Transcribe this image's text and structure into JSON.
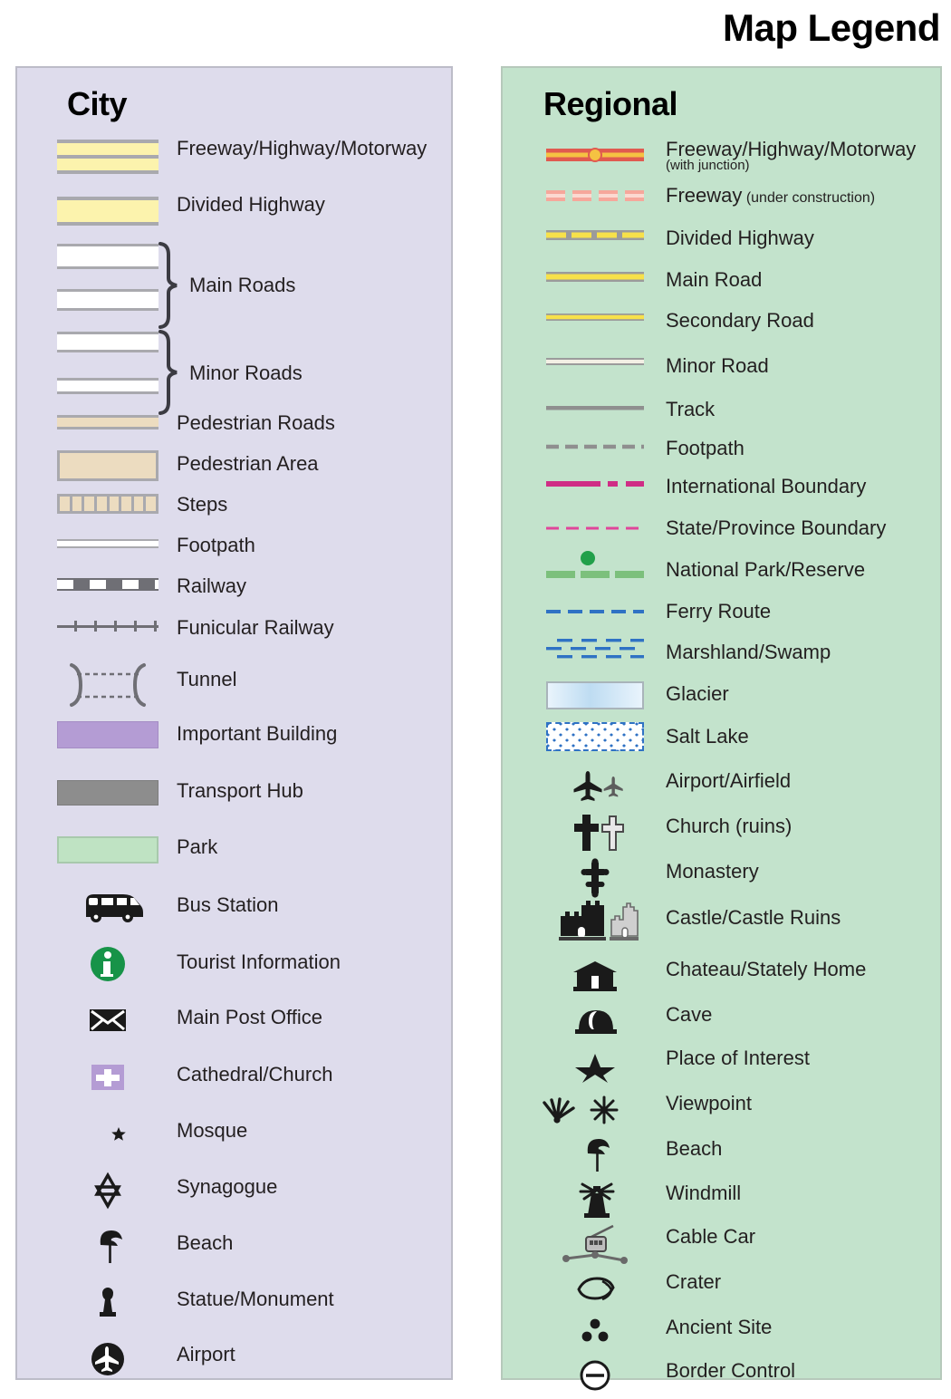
{
  "title": "Map Legend",
  "panels": {
    "city": {
      "heading": "City",
      "bg": "#dedcec",
      "items": [
        {
          "label": "Freeway/Highway/Motorway",
          "symbol": "freeway-double-yellow"
        },
        {
          "label": "Divided Highway",
          "symbol": "divided-highway-yellow"
        },
        {
          "label": "Main Roads",
          "symbol": "main-roads-white-pair-brace"
        },
        {
          "label": "Minor Roads",
          "symbol": "minor-roads-white-pair-brace"
        },
        {
          "label": "Pedestrian Roads",
          "symbol": "pedestrian-road-beige-line"
        },
        {
          "label": "Pedestrian Area",
          "symbol": "pedestrian-area-beige-box"
        },
        {
          "label": "Steps",
          "symbol": "steps-blocks"
        },
        {
          "label": "Footpath",
          "symbol": "footpath-thin-white-line"
        },
        {
          "label": "Railway",
          "symbol": "railway-dashed-gray"
        },
        {
          "label": "Funicular Railway",
          "symbol": "funicular-ticked-line"
        },
        {
          "label": "Tunnel",
          "symbol": "tunnel-dashed-brackets"
        },
        {
          "label": "Important Building",
          "symbol": "important-building-purple-box"
        },
        {
          "label": "Transport Hub",
          "symbol": "transport-hub-gray-box"
        },
        {
          "label": "Park",
          "symbol": "park-green-box"
        },
        {
          "label": "Bus Station",
          "symbol": "bus-icon"
        },
        {
          "label": "Tourist Information",
          "symbol": "tourist-information-icon"
        },
        {
          "label": "Main Post Office",
          "symbol": "envelope-icon"
        },
        {
          "label": "Cathedral/Church",
          "symbol": "cathedral-cross-icon"
        },
        {
          "label": "Mosque",
          "symbol": "mosque-crescent-icon"
        },
        {
          "label": "Synagogue",
          "symbol": "synagogue-star-icon"
        },
        {
          "label": "Beach",
          "symbol": "beach-parasol-icon"
        },
        {
          "label": "Statue/Monument",
          "symbol": "statue-monument-icon"
        },
        {
          "label": "Airport",
          "symbol": "airport-circle-plane-icon"
        }
      ]
    },
    "regional": {
      "heading": "Regional",
      "bg": "#c3e3cc",
      "items": [
        {
          "label": "Freeway/Highway/Motorway",
          "sublabel": "(with junction)",
          "symbol": "freeway-junction-red"
        },
        {
          "label": "Freeway",
          "inline_note": "(under construction)",
          "symbol": "freeway-under-construction-dashes"
        },
        {
          "label": "Divided Highway",
          "symbol": "divided-highway-dashed-yellow"
        },
        {
          "label": "Main Road",
          "symbol": "main-road-yellow"
        },
        {
          "label": "Secondary Road",
          "symbol": "secondary-road-yellow-thin"
        },
        {
          "label": "Minor Road",
          "symbol": "minor-road-white"
        },
        {
          "label": "Track",
          "symbol": "track-gray-solid"
        },
        {
          "label": "Footpath",
          "symbol": "footpath-gray-dashed"
        },
        {
          "label": "International Boundary",
          "symbol": "international-boundary-magenta"
        },
        {
          "label": "State/Province Boundary",
          "symbol": "state-boundary-pink-dashed"
        },
        {
          "label": "National Park/Reserve",
          "symbol": "national-park-green-dash-dot"
        },
        {
          "label": "Ferry Route",
          "symbol": "ferry-route-blue-dashed"
        },
        {
          "label": "Marshland/Swamp",
          "symbol": "marshland-blue-dashes"
        },
        {
          "label": "Glacier",
          "symbol": "glacier-gradient-box"
        },
        {
          "label": "Salt Lake",
          "symbol": "salt-lake-dotted-box"
        },
        {
          "label": "Airport/Airfield",
          "symbol": "airport-airfield-planes-icon"
        },
        {
          "label": "Church (ruins)",
          "symbol": "church-ruins-crosses-icon"
        },
        {
          "label": "Monastery",
          "symbol": "monastery-cross-icon"
        },
        {
          "label": "Castle/Castle Ruins",
          "symbol": "castle-ruins-icon"
        },
        {
          "label": "Chateau/Stately Home",
          "symbol": "chateau-icon"
        },
        {
          "label": "Cave",
          "symbol": "cave-icon"
        },
        {
          "label": "Place of Interest",
          "symbol": "star-icon"
        },
        {
          "label": "Viewpoint",
          "symbol": "viewpoint-burst-icon"
        },
        {
          "label": "Beach",
          "symbol": "beach-parasol-icon"
        },
        {
          "label": "Windmill",
          "symbol": "windmill-icon"
        },
        {
          "label": "Cable Car",
          "symbol": "cable-car-icon"
        },
        {
          "label": "Crater",
          "symbol": "crater-icon"
        },
        {
          "label": "Ancient Site",
          "symbol": "ancient-site-dots-icon"
        },
        {
          "label": "Border Control",
          "symbol": "border-control-icon"
        }
      ]
    }
  },
  "colors": {
    "city_panel_bg": "#dedcec",
    "regional_panel_bg": "#c3e3cc",
    "road_yellow": "#fcf3ad",
    "road_casing_gray": "#a9a9ae",
    "pedestrian_beige": "#ecdcc0",
    "important_building_purple": "#b49cd4",
    "transport_hub_gray": "#8d8d8d",
    "park_green": "#bfe3c3",
    "tourist_info_green": "#179348",
    "freeway_red": "#e05a50",
    "freeway_fill_yellow": "#f5c242",
    "under_construction_pink": "#f6a79b",
    "regional_yellow": "#f7e14a",
    "track_gray": "#8f8f8f",
    "international_boundary": "#cf2d85",
    "state_boundary": "#e0459a",
    "national_park_green": "#7cc07c",
    "national_park_dot": "#21a04a",
    "ferry_blue": "#2f72c4",
    "marshland_blue": "#2f72c4",
    "glacier_blue": "#cfe6f7",
    "text": "#231f20"
  }
}
